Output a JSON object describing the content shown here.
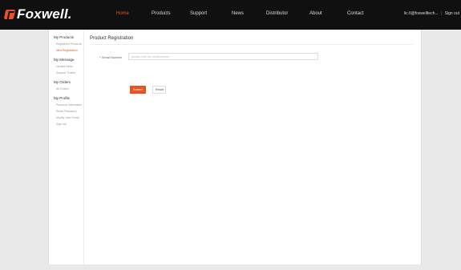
{
  "header": {
    "logo": "Foxwell.",
    "nav": [
      {
        "label": "Home",
        "active": true
      },
      {
        "label": "Products"
      },
      {
        "label": "Support"
      },
      {
        "label": "News"
      },
      {
        "label": "Distributor"
      },
      {
        "label": "About"
      },
      {
        "label": "Contact"
      }
    ],
    "user": "lic.tl@foxwelltech...",
    "separator": "|",
    "sign_out": "Sign out"
  },
  "sidebar": {
    "groups": [
      {
        "title": "My Products",
        "items": [
          {
            "label": "Registered Products"
          },
          {
            "label": "New Registration",
            "active": true
          }
        ]
      },
      {
        "title": "My Message",
        "items": [
          {
            "label": "Update News"
          },
          {
            "label": "Support Tickets"
          }
        ]
      },
      {
        "title": "My Orders",
        "items": [
          {
            "label": "All Orders"
          }
        ]
      },
      {
        "title": "My Profile",
        "items": [
          {
            "label": "Personal Information"
          },
          {
            "label": "Reset Password"
          },
          {
            "label": "Modify User Email"
          },
          {
            "label": "Sign out"
          }
        ]
      }
    ]
  },
  "main": {
    "title": "Product Registration",
    "serial_label": "Serial Number",
    "serial_required": "*",
    "serial_placeholder": "please enter the serial number",
    "submit_label": "Submit",
    "reset_label": "Reset"
  },
  "colors": {
    "accent": "#e8531f",
    "header_bg": "#101010"
  }
}
